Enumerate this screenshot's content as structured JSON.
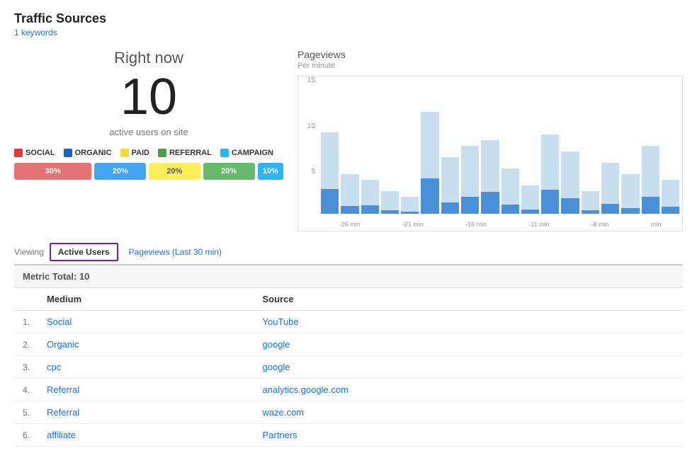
{
  "page": {
    "title": "Traffic Sources",
    "subtitle": "1 keywords"
  },
  "realtime": {
    "right_now_label": "Right now",
    "active_count": "10",
    "active_label": "active users on site"
  },
  "legend": {
    "items": [
      {
        "label": "SOCIAL",
        "color": "#e53935"
      },
      {
        "label": "ORGANIC",
        "color": "#1565c0"
      },
      {
        "label": "PAID",
        "color": "#fdd835"
      },
      {
        "label": "REFERRAL",
        "color": "#43a047"
      },
      {
        "label": "CAMPAIGN",
        "color": "#29b6f6"
      }
    ]
  },
  "bars": [
    {
      "label": "30%",
      "color": "#e57373",
      "flex": 3
    },
    {
      "label": "20%",
      "color": "#42a5f5",
      "flex": 2
    },
    {
      "label": "20%",
      "color": "#ffee58",
      "flex": 2,
      "textColor": "#555"
    },
    {
      "label": "20%",
      "color": "#66bb6a",
      "flex": 2
    },
    {
      "label": "10%",
      "color": "#29b6f6",
      "flex": 1
    }
  ],
  "pageviews": {
    "title": "Pageviews",
    "subtitle": "Per minute",
    "yaxis": [
      "15",
      "10",
      "5"
    ],
    "xaxis": [
      "-26 min",
      "-21 min",
      "-16 min",
      "-11 min",
      "-8 min",
      ""
    ],
    "bars": [
      {
        "height_pct": 72,
        "inner_pct": 30
      },
      {
        "height_pct": 35,
        "inner_pct": 20
      },
      {
        "height_pct": 30,
        "inner_pct": 25
      },
      {
        "height_pct": 20,
        "inner_pct": 15
      },
      {
        "height_pct": 15,
        "inner_pct": 10
      },
      {
        "height_pct": 90,
        "inner_pct": 35
      },
      {
        "height_pct": 50,
        "inner_pct": 20
      },
      {
        "height_pct": 60,
        "inner_pct": 25
      },
      {
        "height_pct": 65,
        "inner_pct": 30
      },
      {
        "height_pct": 40,
        "inner_pct": 20
      },
      {
        "height_pct": 25,
        "inner_pct": 15
      },
      {
        "height_pct": 70,
        "inner_pct": 30
      },
      {
        "height_pct": 55,
        "inner_pct": 25
      },
      {
        "height_pct": 20,
        "inner_pct": 15
      },
      {
        "height_pct": 45,
        "inner_pct": 20
      },
      {
        "height_pct": 35,
        "inner_pct": 15
      },
      {
        "height_pct": 60,
        "inner_pct": 25
      },
      {
        "height_pct": 30,
        "inner_pct": 20
      }
    ]
  },
  "tabs": {
    "viewing_label": "Viewing",
    "active_tab": "Active Users",
    "inactive_tab": "Pageviews (Last 30 min)"
  },
  "metric_total": {
    "label": "Metric Total:",
    "value": "10"
  },
  "table": {
    "headers": [
      "",
      "Medium",
      "Source"
    ],
    "rows": [
      {
        "num": "1.",
        "medium": "Social",
        "source": "YouTube"
      },
      {
        "num": "2.",
        "medium": "Organic",
        "source": "google"
      },
      {
        "num": "3.",
        "medium": "cpc",
        "source": "google"
      },
      {
        "num": "4.",
        "medium": "Referral",
        "source": "analytics.google.com"
      },
      {
        "num": "5.",
        "medium": "Referral",
        "source": "waze.com"
      },
      {
        "num": "6.",
        "medium": "affiliate",
        "source": "Partners"
      }
    ]
  }
}
